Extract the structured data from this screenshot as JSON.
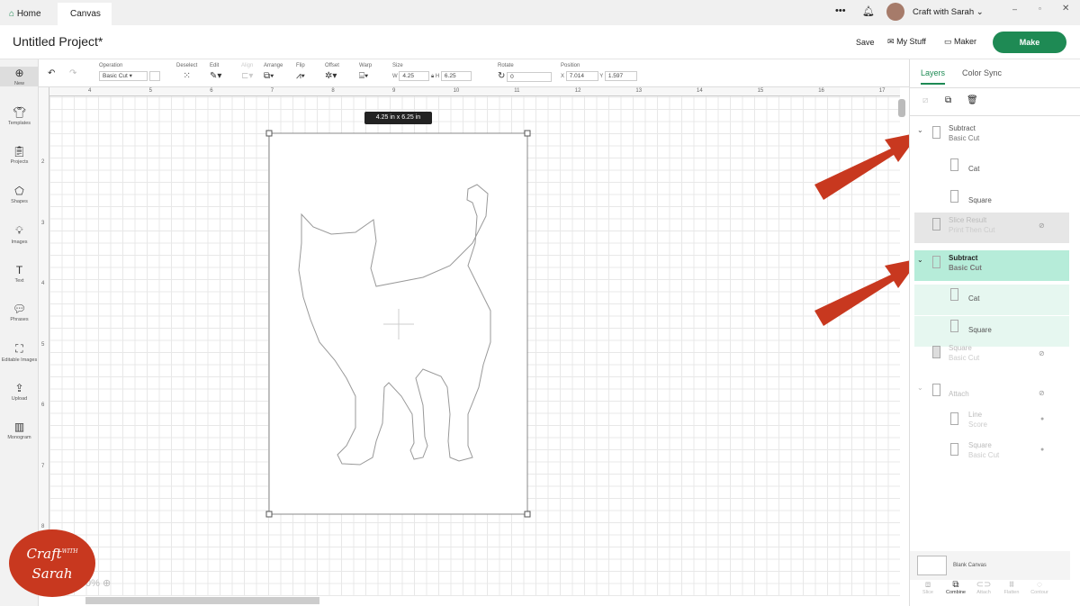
{
  "tabs": {
    "home": "Home",
    "canvas": "Canvas"
  },
  "account": {
    "name": "Craft with Sarah",
    "more": "•••"
  },
  "header": {
    "title": "Untitled Project*",
    "save": "Save",
    "my_stuff": "My Stuff",
    "maker": "Maker",
    "make": "Make"
  },
  "toolbar": {
    "operation_label": "Operation",
    "operation_value": "Basic Cut",
    "deselect": "Deselect",
    "edit": "Edit",
    "align": "Align",
    "arrange": "Arrange",
    "flip": "Flip",
    "offset": "Offset",
    "warp": "Warp",
    "size_label": "Size",
    "w_label": "W",
    "w_value": "4.25",
    "h_label": "H",
    "h_value": "6.25",
    "rotate_label": "Rotate",
    "rotate_value": "0",
    "position_label": "Position",
    "x_label": "X",
    "x_value": "7.014",
    "y_label": "Y",
    "y_value": "1.597"
  },
  "sidebar": {
    "items": [
      {
        "label": "New",
        "icon": "plus-circle-icon"
      },
      {
        "label": "Templates",
        "icon": "shirt-icon"
      },
      {
        "label": "Projects",
        "icon": "clipboard-icon"
      },
      {
        "label": "Shapes",
        "icon": "shapes-icon"
      },
      {
        "label": "Images",
        "icon": "lightbulb-icon"
      },
      {
        "label": "Text",
        "icon": "text-icon"
      },
      {
        "label": "Phrases",
        "icon": "speech-icon"
      },
      {
        "label": "Editable Images",
        "icon": "edit-image-icon"
      },
      {
        "label": "Upload",
        "icon": "upload-icon"
      },
      {
        "label": "Monogram",
        "icon": "monogram-icon"
      }
    ]
  },
  "ruler": {
    "top": [
      "4",
      "5",
      "6",
      "7",
      "8",
      "9",
      "10",
      "11",
      "12",
      "13",
      "14",
      "15",
      "16",
      "17"
    ],
    "left": [
      "2",
      "3",
      "4",
      "5",
      "6",
      "7",
      "8"
    ]
  },
  "canvas": {
    "size_tooltip": "4.25  in x 6.25  in",
    "zoom": "0%"
  },
  "panel": {
    "tabs": [
      "Layers",
      "Color Sync"
    ],
    "layers": [
      {
        "name": "Subtract",
        "sub": "Basic Cut",
        "state": "normal"
      },
      {
        "name": "Cat",
        "child": true
      },
      {
        "name": "Square",
        "child": true
      },
      {
        "name": "Slice Result",
        "sub": "Print Then Cut",
        "state": "hidden"
      },
      {
        "name": "Subtract",
        "sub": "Basic Cut",
        "state": "selected"
      },
      {
        "name": "Cat",
        "child": true
      },
      {
        "name": "Square",
        "child": true
      },
      {
        "name": "Square",
        "sub": "Basic Cut",
        "state": "hidden"
      },
      {
        "name": "Attach",
        "state": "hidden"
      },
      {
        "name": "Line",
        "sub": "Score",
        "child": true
      },
      {
        "name": "Square",
        "sub": "Basic Cut",
        "child": true
      }
    ],
    "blank_canvas": "Blank Canvas",
    "bottom": [
      "Slice",
      "Combine",
      "Attach",
      "Flatten",
      "Contour"
    ]
  },
  "colors": {
    "accent": "#1e8a54",
    "selected_layer": "#b6ecd9",
    "selected_children": "#e6f7f0",
    "arrow": "#c8381f",
    "logo": "#c8381f"
  },
  "logo": {
    "text": "Craft with Sarah"
  }
}
